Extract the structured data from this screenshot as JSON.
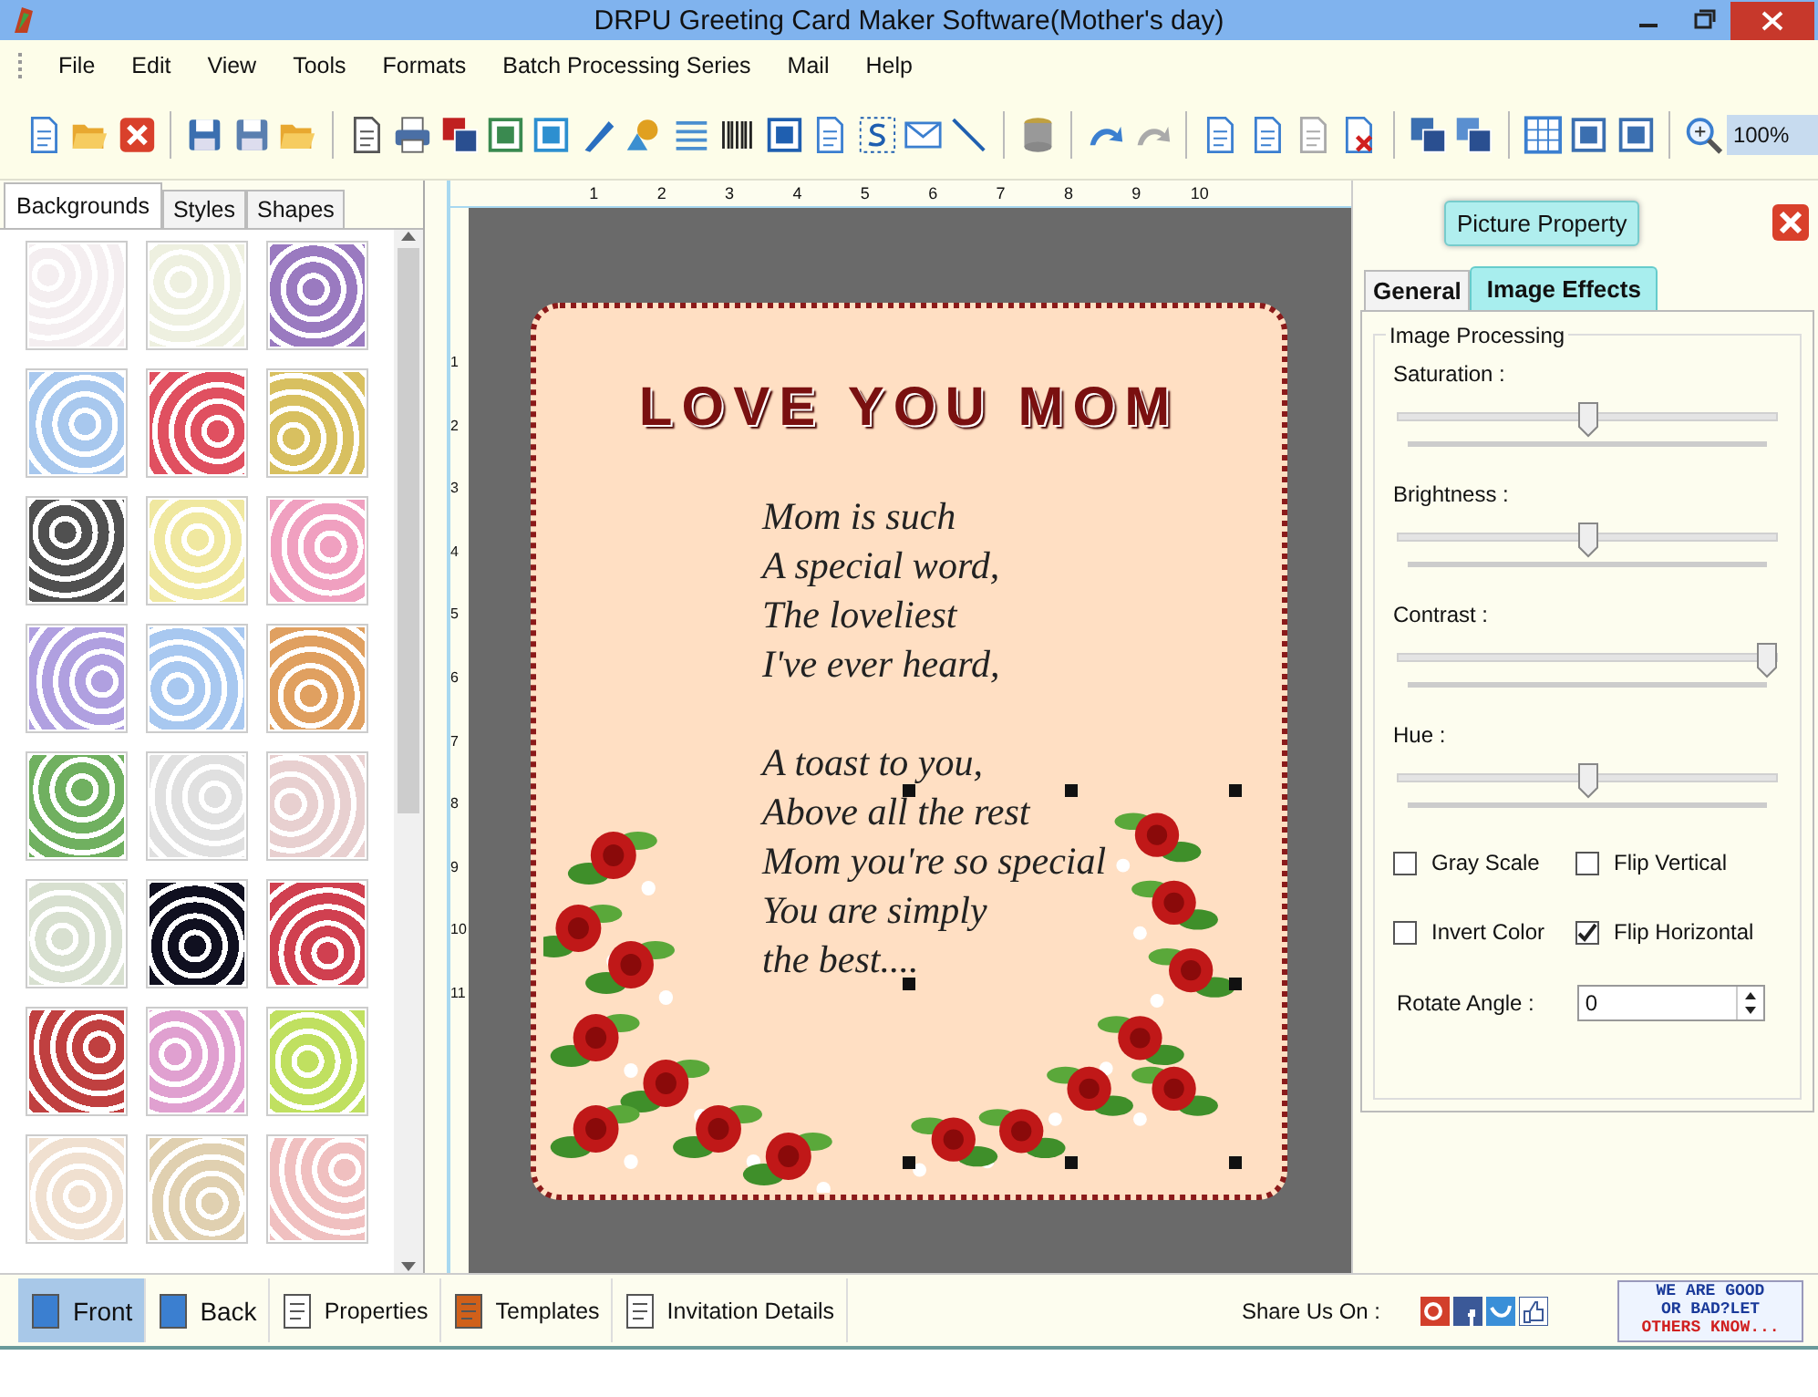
{
  "window": {
    "title": "DRPU Greeting Card Maker Software(Mother's day)"
  },
  "menu": [
    "File",
    "Edit",
    "View",
    "Tools",
    "Formats",
    "Batch Processing Series",
    "Mail",
    "Help"
  ],
  "toolbar": {
    "zoom": "100%"
  },
  "left_panel": {
    "tabs": [
      {
        "label": "Backgrounds",
        "selected": true
      },
      {
        "label": "Styles",
        "selected": false
      },
      {
        "label": "Shapes",
        "selected": false
      }
    ]
  },
  "rulers": {
    "horizontal": [
      "1",
      "2",
      "3",
      "4",
      "5",
      "6",
      "7",
      "8",
      "9",
      "10"
    ],
    "vertical": [
      "1",
      "2",
      "3",
      "4",
      "5",
      "6",
      "7",
      "8",
      "9",
      "10",
      "11"
    ]
  },
  "card": {
    "heading": "LOVE YOU MOM",
    "stanzas": [
      [
        "Mom is such",
        "A special word,",
        "The loveliest",
        "I've ever heard,"
      ],
      [
        "A toast to you,",
        "Above all the rest",
        "Mom you're so special",
        "You are simply",
        "the best...."
      ]
    ],
    "picture_selected": true
  },
  "properties_panel": {
    "title": "Picture Property",
    "tabs": [
      {
        "label": "General",
        "selected": false
      },
      {
        "label": "Image Effects",
        "selected": true
      }
    ],
    "group": "Image Processing",
    "sliders": [
      {
        "label": "Saturation :",
        "level": 0.5
      },
      {
        "label": "Brightness :",
        "level": 0.5
      },
      {
        "label": "Contrast :",
        "level": 0.97
      },
      {
        "label": "Hue :",
        "level": 0.5
      }
    ],
    "checkboxes": [
      {
        "label": "Gray Scale",
        "checked": false
      },
      {
        "label": "Flip Vertical",
        "checked": false
      },
      {
        "label": "Invert Color",
        "checked": false
      },
      {
        "label": "Flip Horizontal",
        "checked": true
      }
    ],
    "rotate": {
      "label": "Rotate Angle :",
      "value": "0"
    }
  },
  "bottom_bar": {
    "tabs": [
      {
        "label": "Front",
        "selected": true
      },
      {
        "label": "Back",
        "selected": false
      },
      {
        "label": "Properties",
        "selected": false
      },
      {
        "label": "Templates",
        "selected": false
      },
      {
        "label": "Invitation Details",
        "selected": false
      }
    ],
    "share_label": "Share Us On :",
    "feedback": [
      "WE ARE GOOD",
      "OR BAD?LET",
      "OTHERS KNOW..."
    ]
  }
}
